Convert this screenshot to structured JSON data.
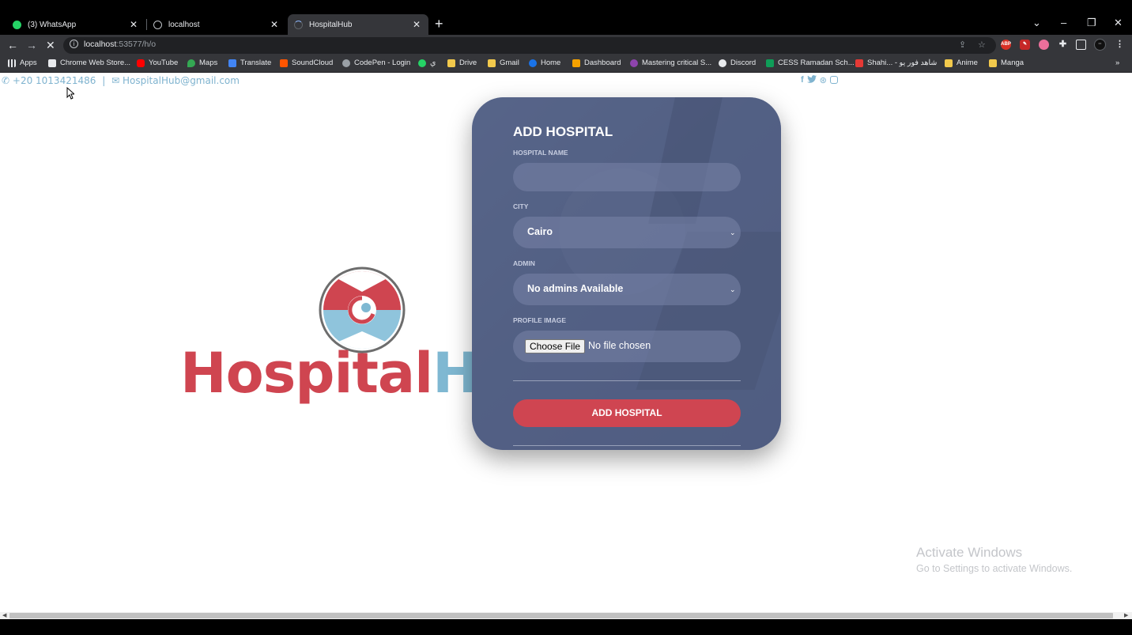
{
  "browser": {
    "tabs": [
      {
        "label": "(3) WhatsApp",
        "icon": "whatsapp-icon",
        "active": false
      },
      {
        "label": "localhost",
        "icon": "globe-icon",
        "active": false
      },
      {
        "label": "HospitalHub",
        "icon": "loading-icon",
        "active": true
      }
    ],
    "close_glyph": "✕",
    "newtab_glyph": "+",
    "url_host": "localhost",
    "url_rest": ":53577/h/o",
    "bookmarks": [
      {
        "label": "Apps",
        "icon": "apps-grid-icon",
        "color": "#e8eaed"
      },
      {
        "label": "Chrome Web Store...",
        "icon": "chrome-web-store-icon",
        "color": "#e8eaed"
      },
      {
        "label": "YouTube",
        "icon": "youtube-icon",
        "color": "#ff0000"
      },
      {
        "label": "Maps",
        "icon": "maps-pin-icon",
        "color": "#34a853"
      },
      {
        "label": "Translate",
        "icon": "translate-icon",
        "color": "#4285f4"
      },
      {
        "label": "SoundCloud",
        "icon": "soundcloud-icon",
        "color": "#ff5500"
      },
      {
        "label": "CodePen - Login",
        "icon": "codepen-icon",
        "color": "#bdc1c6"
      },
      {
        "label": "ي",
        "icon": "whatsapp-icon",
        "color": "#25d366"
      },
      {
        "label": "Drive",
        "icon": "folder-icon",
        "color": "#f2c94c"
      },
      {
        "label": "Gmail",
        "icon": "folder-icon",
        "color": "#f2c94c"
      },
      {
        "label": "Home",
        "icon": "home-globe-icon",
        "color": "#1a73e8"
      },
      {
        "label": "Dashboard",
        "icon": "dashboard-icon",
        "color": "#f4a100"
      },
      {
        "label": "Mastering critical S...",
        "icon": "mastering-icon",
        "color": "#8e44ad"
      },
      {
        "label": "Discord",
        "icon": "discord-icon",
        "color": "#e8eaed"
      },
      {
        "label": "CESS Ramadan Sch...",
        "icon": "sheets-icon",
        "color": "#0f9d58"
      },
      {
        "label": "Shahi... - شاهد فور يو",
        "icon": "shahid-icon",
        "color": "#e53935"
      },
      {
        "label": "Anime",
        "icon": "folder-icon",
        "color": "#f2c94c"
      },
      {
        "label": "Manga",
        "icon": "folder-icon",
        "color": "#f2c94c"
      }
    ],
    "bookmarks_overflow": "»"
  },
  "header": {
    "phone_icon": "phone-icon",
    "phone": "+20 1013421486",
    "separator": "|",
    "email_icon": "mail-icon",
    "email": "HospitalHub@gmail.com",
    "socials": [
      "facebook-icon",
      "twitter-icon",
      "dribbble-icon",
      "instagram-icon"
    ]
  },
  "brand": {
    "part1": "Hospital",
    "part2": "Hub",
    "color1": "#cf4550",
    "color2": "#7fb8d2"
  },
  "form": {
    "title": "ADD HOSPITAL",
    "name_label": "HOSPITAL NAME",
    "name_value": "",
    "city_label": "CITY",
    "city_value": "Cairo",
    "admin_label": "ADMIN",
    "admin_value": "No admins Available",
    "image_label": "PROFILE IMAGE",
    "choose_file": "Choose File",
    "no_file": "No file chosen",
    "submit_label": "ADD HOSPITAL",
    "accent": "#cf4551"
  },
  "watermark": {
    "line1": "Activate Windows",
    "line2": "Go to Settings to activate Windows."
  }
}
